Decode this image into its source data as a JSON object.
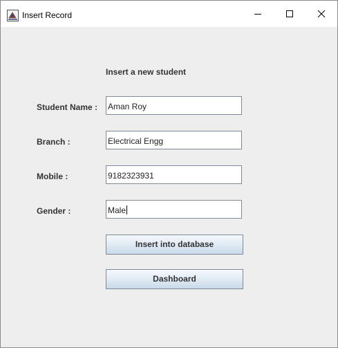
{
  "window": {
    "title": "Insert Record"
  },
  "form": {
    "heading": "Insert a new student",
    "fields": [
      {
        "label": "Student Name :",
        "value": "Aman Roy"
      },
      {
        "label": "Branch :",
        "value": "Electrical Engg"
      },
      {
        "label": "Mobile :",
        "value": "9182323931"
      },
      {
        "label": "Gender :",
        "value": "Male"
      }
    ],
    "buttons": {
      "insert": "Insert into database",
      "dashboard": "Dashboard"
    }
  },
  "icons": {
    "app": "java-app-icon",
    "minimize": "minimize-icon",
    "maximize": "maximize-icon",
    "close": "close-icon"
  }
}
